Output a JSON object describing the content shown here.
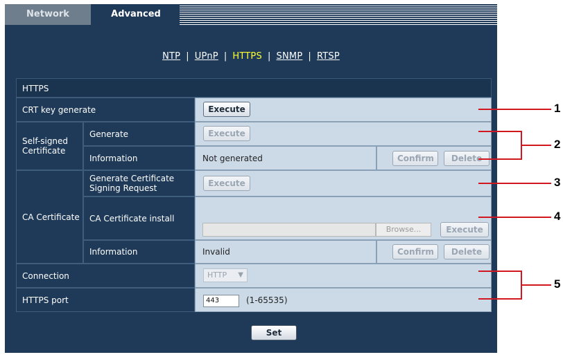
{
  "tabs": {
    "network": "Network",
    "advanced": "Advanced"
  },
  "nav": {
    "ntp": "NTP",
    "upnp": "UPnP",
    "https": "HTTPS",
    "snmp": "SNMP",
    "rtsp": "RTSP",
    "sep": "|"
  },
  "section_title": "HTTPS",
  "rows": {
    "crt_key": {
      "label": "CRT key generate",
      "button": "Execute"
    },
    "self_signed": {
      "group_label": "Self-signed Certificate",
      "generate_label": "Generate",
      "generate_button": "Execute",
      "info_label": "Information",
      "info_value": "Not generated",
      "confirm_button": "Confirm",
      "delete_button": "Delete"
    },
    "ca": {
      "group_label": "CA Certificate",
      "csr_label": "Generate Certificate Signing Request",
      "csr_button": "Execute",
      "install_label": "CA Certificate install",
      "browse_button": "Browse...",
      "install_button": "Execute",
      "info_label": "Information",
      "info_value": "Invalid",
      "confirm_button": "Confirm",
      "delete_button": "Delete"
    },
    "connection": {
      "label": "Connection",
      "value": "HTTP"
    },
    "https_port": {
      "label": "HTTPS port",
      "value": "443",
      "range": "(1-65535)"
    }
  },
  "set_button": "Set",
  "callouts": [
    "1",
    "2",
    "3",
    "4",
    "5"
  ]
}
